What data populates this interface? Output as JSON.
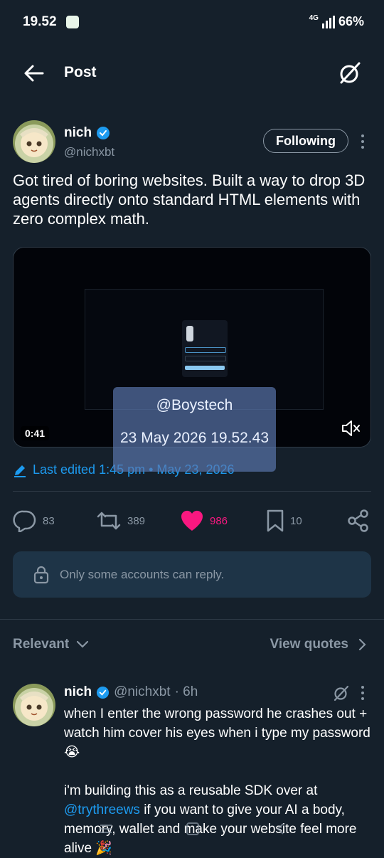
{
  "status_bar": {
    "time": "19.52",
    "network": "4G",
    "battery": "66%"
  },
  "header": {
    "title": "Post"
  },
  "post": {
    "author": {
      "name": "nich",
      "handle": "@nichxbt"
    },
    "follow_label": "Following",
    "text": "Got tired of boring websites. Built a way to drop 3D agents directly onto standard HTML elements with zero complex math.",
    "video": {
      "duration": "0:41"
    },
    "edited": "Last edited 1:45 pm • May 23, 2026",
    "stats": {
      "replies": "83",
      "reposts": "389",
      "likes": "986",
      "bookmarks": "10"
    },
    "reply_restriction": "Only some accounts can reply."
  },
  "watermark": {
    "user": "@Boystech",
    "timestamp": "23 May 2026 19.52.43"
  },
  "replies_section": {
    "sort_label": "Relevant",
    "view_quotes_label": "View quotes"
  },
  "reply": {
    "name": "nich",
    "handle": "@nichxbt",
    "time": "· 6h",
    "line1": "when I enter the wrong password he crashes out + watch him cover his eyes when i type my password 😭",
    "line2_pre": "i'm building this as a reusable SDK over at ",
    "line2_mention": "@trythreews",
    "line2_post": " if you want to give your AI a body, memory, wallet and make your website feel more alive 🎉"
  },
  "colors": {
    "background": "#15202b",
    "accent": "#1d9bf0",
    "like": "#f91880",
    "muted": "#8b98a5"
  },
  "icons": [
    "back-arrow-icon",
    "grok-icon",
    "verified-badge-icon",
    "more-vertical-icon",
    "mute-icon",
    "edit-pencil-icon",
    "reply-icon",
    "repost-icon",
    "heart-icon",
    "bookmark-icon",
    "share-icon",
    "lock-icon",
    "chevron-down-icon",
    "chevron-right-icon"
  ]
}
